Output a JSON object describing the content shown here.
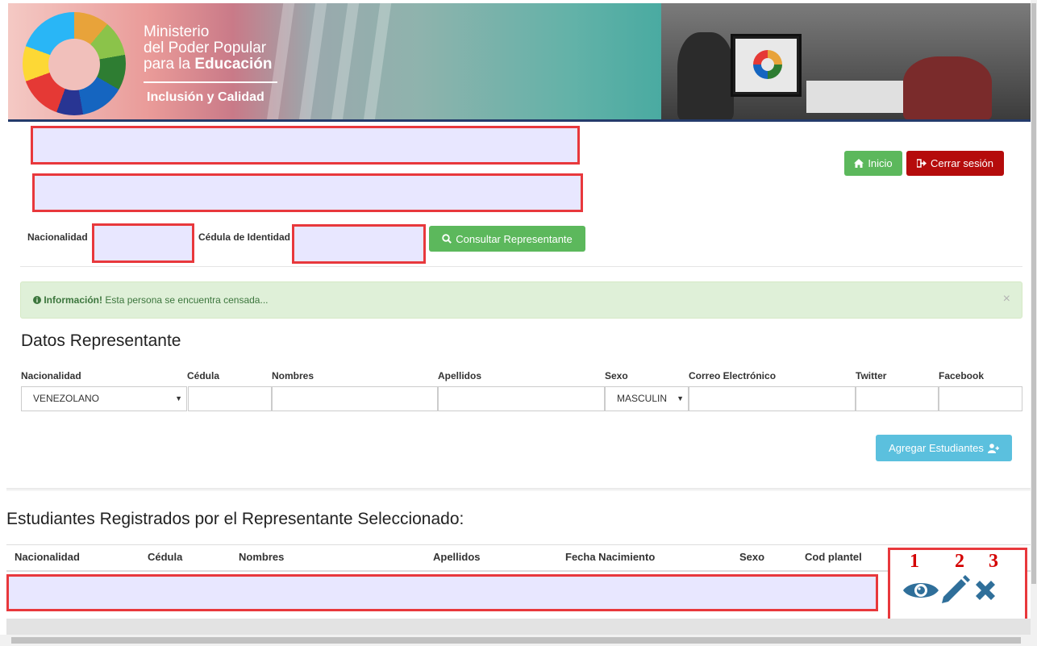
{
  "header": {
    "brand_line1": "Ministerio",
    "brand_line2": "del Poder Popular",
    "brand_line3_prefix": "para la ",
    "brand_line3_bold": "Educación",
    "tagline": "Inclusión y Calidad"
  },
  "nav": {
    "inicio_label": "Inicio",
    "logout_label": "Cerrar sesión"
  },
  "search": {
    "nacionalidad_label": "Nacionalidad",
    "cedula_label": "Cédula de Identidad",
    "consult_button": "Consultar Representante"
  },
  "alert": {
    "title": "Información!",
    "message": " Esta persona se encuentra censada...",
    "close": "×"
  },
  "representante": {
    "heading": "Datos Representante",
    "labels": {
      "nacionalidad": "Nacionalidad",
      "cedula": "Cédula",
      "nombres": "Nombres",
      "apellidos": "Apellidos",
      "sexo": "Sexo",
      "correo": "Correo Electrónico",
      "twitter": "Twitter",
      "facebook": "Facebook"
    },
    "values": {
      "nacionalidad": "VENEZOLANO",
      "sexo": "MASCULIN"
    },
    "add_students_button": "Agregar Estudiantes"
  },
  "students": {
    "heading": "Estudiantes Registrados por el Representante Seleccionado:",
    "columns": [
      "Nacionalidad",
      "Cédula",
      "Nombres",
      "Apellidos",
      "Fecha Nacimiento",
      "Sexo",
      "Cod plantel"
    ]
  },
  "action_callouts": [
    "1",
    "2",
    "3"
  ],
  "icons": {
    "home": "home-icon",
    "logout": "sign-out-icon",
    "search": "search-icon",
    "info": "info-circle-icon",
    "add_user": "user-plus-icon",
    "view": "eye-icon",
    "edit": "pencil-icon",
    "delete": "x-icon"
  },
  "colors": {
    "accent_green": "#5cb85c",
    "logout_red": "#b50c0c",
    "info_blue": "#5bc0de",
    "redaction_border": "#e8383c",
    "action_icon": "#2f6f9a"
  }
}
